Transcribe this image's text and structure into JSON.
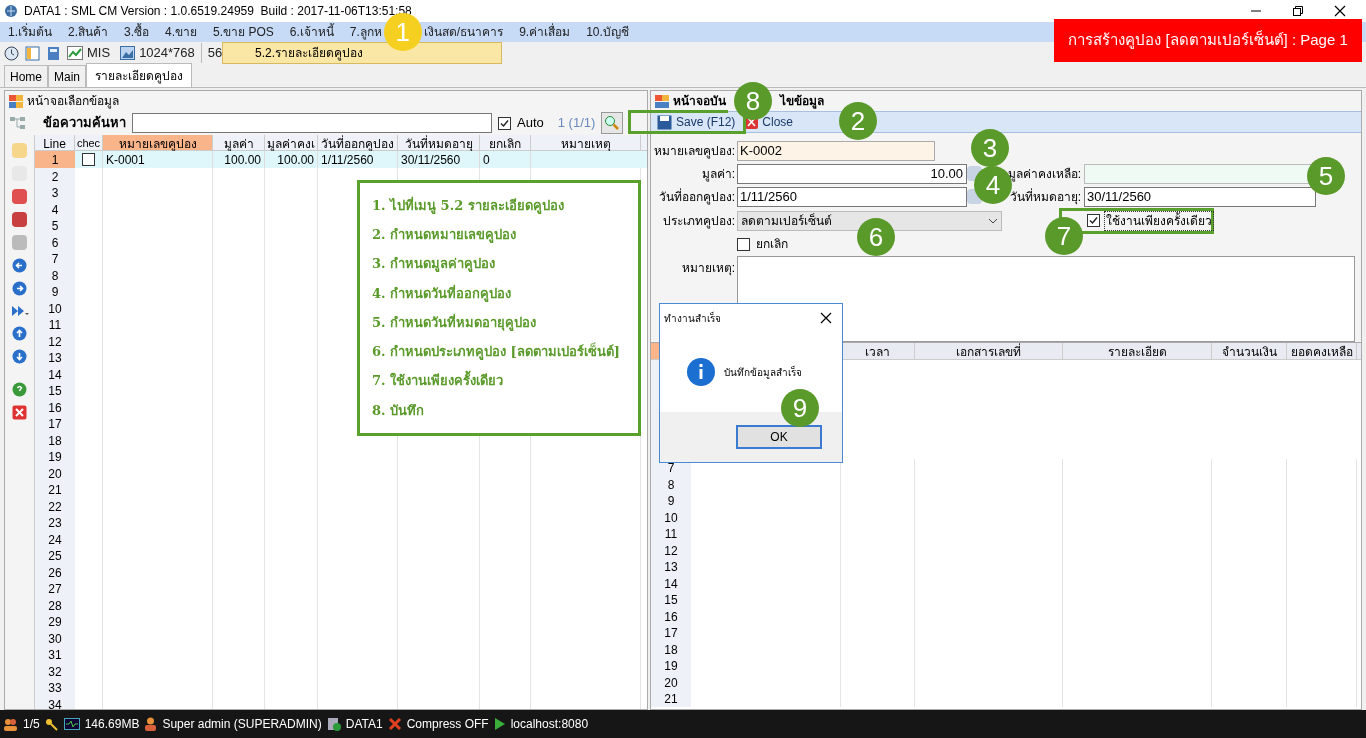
{
  "window": {
    "title": "DATA1 : SML CM Version : 1.0.6519.24959  Build : 2017-11-06T13:51:58"
  },
  "menu": [
    "1.เริ่มต้น",
    "2.สินค้า",
    "3.ซื้อ",
    "4.ขาย",
    "5.ขาย POS",
    "6.เจ้าหนี้",
    "7.ลูกห",
    "เงินสด/ธนาคาร",
    "9.ค่าเสื่อม",
    "10.บัญชี"
  ],
  "toolbar": {
    "mis": "MIS",
    "resolution": "1024*768",
    "partial": "56"
  },
  "open_submenu": {
    "item": "5.2.รายละเอียดคูปอง"
  },
  "banner": "การสร้างคูปอง [ลดตามเปอร์เซ็นต์] : Page 1",
  "tabs": [
    {
      "label": "Home",
      "selected": false
    },
    {
      "label": "Main",
      "selected": false
    },
    {
      "label": "รายละเอียดคูปอง",
      "selected": true
    }
  ],
  "left_panel": {
    "title": "หน้าจอเลือกข้อมูล",
    "search_label": "ข้อความค้นหา",
    "auto": {
      "label": "Auto",
      "checked": true
    },
    "page": "1 (1/1)",
    "columns": [
      "Line",
      "chec",
      "หมายเลขคูปอง",
      "มูลค่า",
      "มูลค่าคงเ",
      "วันที่ออกคูปอง",
      "วันที่หมดอายุ",
      "ยกเลิก",
      "หมายเหตุ"
    ],
    "rows": [
      {
        "selected": true,
        "checked": false,
        "cells": [
          "1",
          "",
          "K-0001",
          "100.00",
          "100.00",
          "1/11/2560",
          "30/11/2560",
          "0"
        ]
      }
    ],
    "blank_lines": [
      "2",
      "3",
      "4",
      "5",
      "6",
      "7",
      "8",
      "9",
      "10",
      "11",
      "12",
      "13",
      "14",
      "15",
      "16",
      "17",
      "18",
      "19",
      "20",
      "21",
      "22",
      "23",
      "24",
      "25",
      "26",
      "27",
      "28",
      "29",
      "30",
      "31",
      "32",
      "33",
      "34"
    ]
  },
  "instructions": [
    "1. ไปที่เมนู 5.2 รายละเอียดคูปอง",
    "2. กำหนดหมายเลขคูปอง",
    "3. กำหนดมูลค่าคูปอง",
    "4. กำหนดวันที่ออกคูปอง",
    "5. กำหนดวันที่หมดอายุคูปอง",
    "6. กำหนดประเภทคูปอง [ลดตามเปอร์เซ็นต์]",
    "7. ใช้งานเพียงครั้งเดียว",
    "8. บันทึก"
  ],
  "form": {
    "title_start": "หน้าจอบัน",
    "title_end": "ไขข้อมูล",
    "save": "Save (F12)",
    "close": "Close",
    "coupon_no": {
      "label": "หมายเลขคูปอง:",
      "value": "K-0002"
    },
    "amount": {
      "label": "มูลค่า:",
      "value": "10.00"
    },
    "remaining": {
      "label": "มูลค่าคงเหลือ:"
    },
    "issue_date": {
      "label": "วันที่ออกคูปอง:",
      "value": "1/11/2560"
    },
    "expire_date": {
      "label": "วันที่หมดอายุ:",
      "value": "30/11/2560"
    },
    "coupon_type": {
      "label": "ประเภทคูปอง:",
      "value": "ลดตามเปอร์เซ็นต์"
    },
    "once": {
      "label": "ใช้งานเพียงครั้งเดียว",
      "checked": true
    },
    "cancel": {
      "label": "ยกเลิก",
      "checked": false
    },
    "note": {
      "label": "หมายเหตุ:"
    }
  },
  "detail_grid": {
    "columns": [
      "เวลา",
      "เอกสารเลขที่",
      "รายละเอียด",
      "จำนวนเงิน",
      "ยอดคงเหลือ"
    ],
    "lines": [
      "7",
      "8",
      "9",
      "10",
      "11",
      "12",
      "13",
      "14",
      "15",
      "16",
      "17",
      "18",
      "19",
      "20",
      "21"
    ]
  },
  "dialog": {
    "title": "ทำงานสำเร็จ",
    "message": "บันทึกข้อมูลสำเร็จ",
    "button": "OK"
  },
  "callouts": [
    "1",
    "2",
    "3",
    "4",
    "5",
    "6",
    "7",
    "8",
    "9"
  ],
  "status_bar": [
    "1/5",
    "146.69MB",
    "Super admin (SUPERADMIN)",
    "DATA1",
    "Compress OFF",
    "localhost:8080"
  ]
}
